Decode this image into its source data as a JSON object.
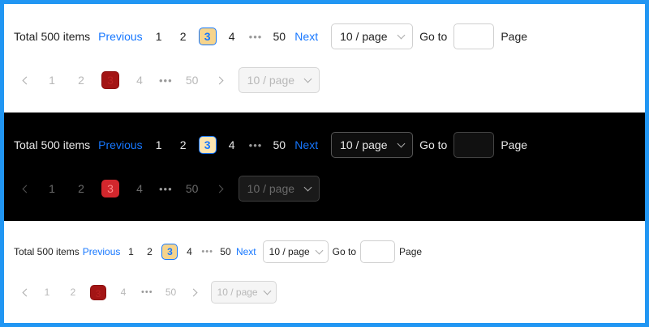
{
  "pagination": {
    "total_label": "Total 500 items",
    "previous_label": "Previous",
    "next_label": "Next",
    "pages": [
      "1",
      "2",
      "3",
      "4",
      "50"
    ],
    "active_page": "3",
    "ellipsis": "•••",
    "page_size": "10 / page",
    "goto_label": "Go to",
    "goto_value": "",
    "page_suffix": "Page"
  },
  "colors": {
    "frame_border": "#2196f3",
    "accent": "#1677ff",
    "active_bg": "#f6d48c",
    "disabled_active_light": "#a31515",
    "disabled_active_dark": "#d2272d"
  }
}
